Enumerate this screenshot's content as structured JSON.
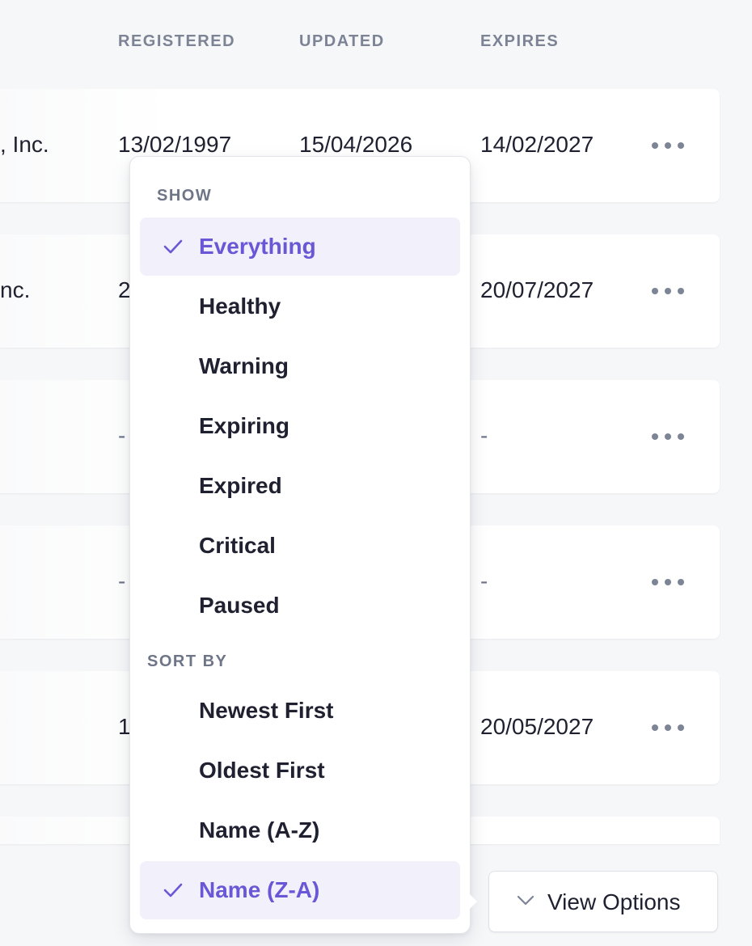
{
  "columns": {
    "registered": "REGISTERED",
    "updated": "UPDATED",
    "expires": "EXPIRES"
  },
  "rows": [
    {
      "name": ", Inc.",
      "registered": "13/02/1997",
      "updated": "15/04/2026",
      "expires": "14/02/2027"
    },
    {
      "name": "nc.",
      "registered": "2",
      "updated": "",
      "expires": "20/07/2027"
    },
    {
      "name": "",
      "registered": "-",
      "updated": "",
      "expires": "-"
    },
    {
      "name": "",
      "registered": "-",
      "updated": "",
      "expires": "-"
    },
    {
      "name": "",
      "registered": "1",
      "updated": "",
      "expires": "20/05/2027"
    }
  ],
  "menu": {
    "show_label": "SHOW",
    "show_items": [
      {
        "label": "Everything",
        "selected": true
      },
      {
        "label": "Healthy",
        "selected": false
      },
      {
        "label": "Warning",
        "selected": false
      },
      {
        "label": "Expiring",
        "selected": false
      },
      {
        "label": "Expired",
        "selected": false
      },
      {
        "label": "Critical",
        "selected": false
      },
      {
        "label": "Paused",
        "selected": false
      }
    ],
    "sort_label": "SORT BY",
    "sort_items": [
      {
        "label": "Newest First",
        "selected": false
      },
      {
        "label": "Oldest First",
        "selected": false
      },
      {
        "label": "Name (A-Z)",
        "selected": false
      },
      {
        "label": "Name (Z-A)",
        "selected": true
      }
    ]
  },
  "view_options": {
    "label": "View Options"
  },
  "icons": {
    "check": "check-icon",
    "chevron": "chevron-down-icon",
    "more": "more-horizontal-icon"
  },
  "colors": {
    "accent": "#6a57d6",
    "selected_bg": "#f1f0fb",
    "text": "#1f2130",
    "muted": "#7c8395"
  }
}
